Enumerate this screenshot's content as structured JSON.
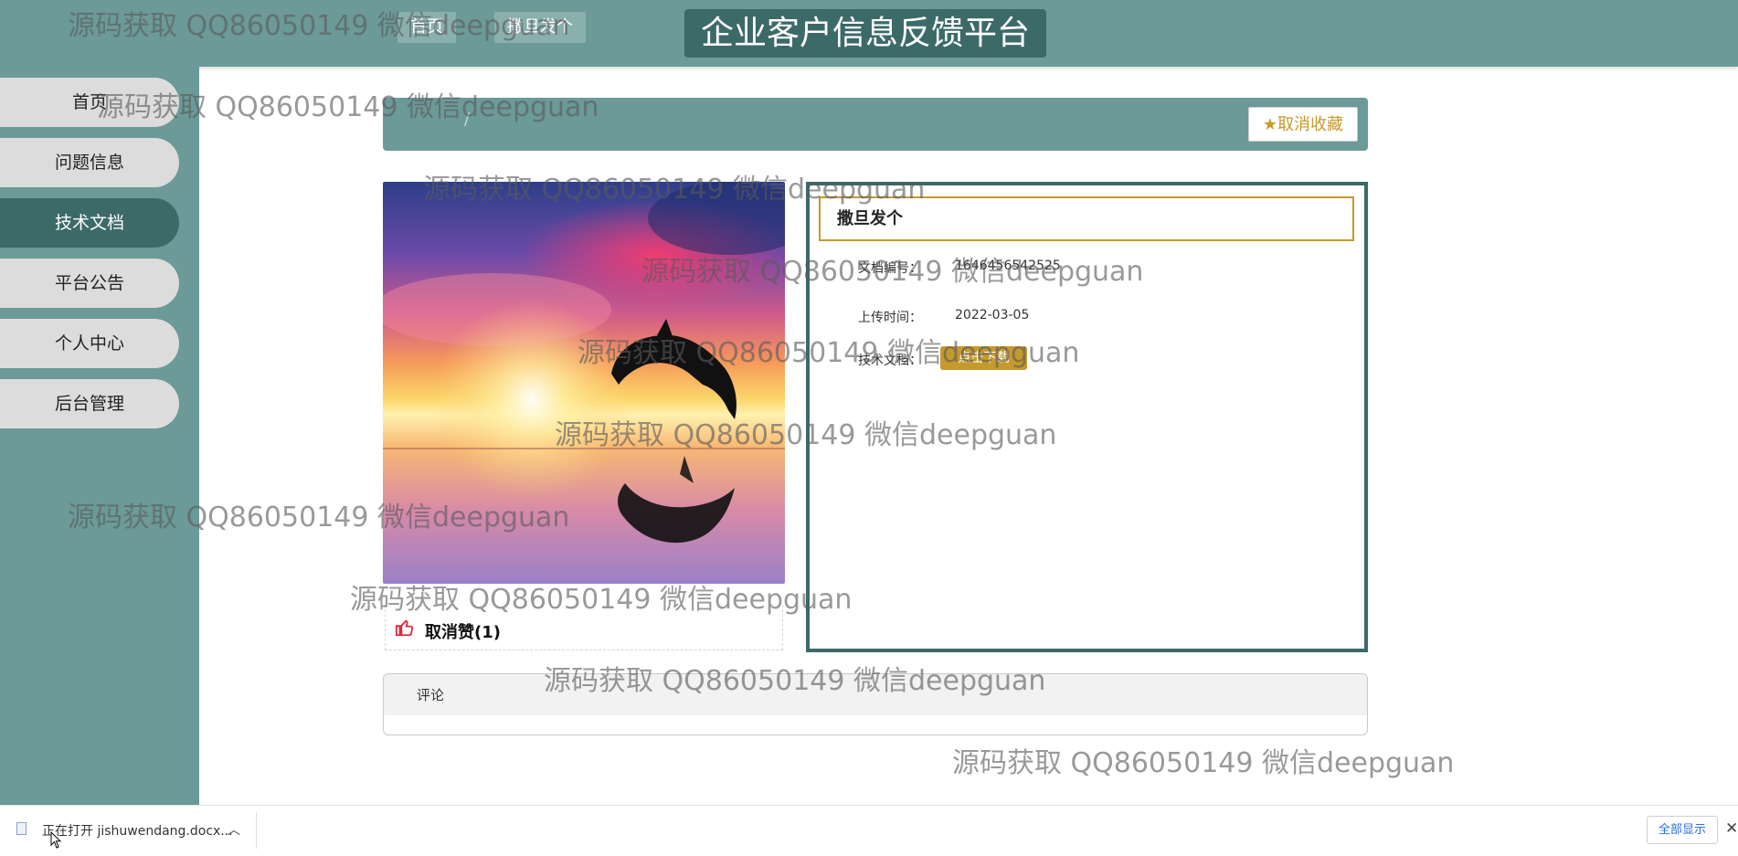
{
  "header": {
    "title": "企业客户信息反馈平台"
  },
  "sidebar": {
    "items": [
      {
        "label": "首页"
      },
      {
        "label": "问题信息"
      },
      {
        "label": "技术文档"
      },
      {
        "label": "平台公告"
      },
      {
        "label": "个人中心"
      },
      {
        "label": "后台管理"
      }
    ],
    "active_index": 2
  },
  "breadcrumb": {
    "home": "首页",
    "separator": "/",
    "current": "撒旦发个"
  },
  "favorite_button": {
    "label": "取消收藏",
    "icon": "star-icon"
  },
  "detail": {
    "title": "撒旦发个",
    "fields": [
      {
        "label": "文档编号：",
        "value": "1646456542525"
      },
      {
        "label": "上传时间：",
        "value": "2022-03-05"
      },
      {
        "label": "技术文档：",
        "button": "点击下载"
      }
    ]
  },
  "like": {
    "label": "取消赞(1)",
    "icon": "thumbs-up-icon"
  },
  "comment": {
    "label": "评论"
  },
  "watermark": {
    "text": "源码获取 QQ86050149 微信deepguan"
  },
  "download_bar": {
    "file_text": "正在打开 jishuwendang.docx...",
    "show_all": "全部显示",
    "close": "✕"
  },
  "colors": {
    "primary": "#6b9a98",
    "dark": "#3c6a68",
    "accent": "#c59a2c"
  }
}
